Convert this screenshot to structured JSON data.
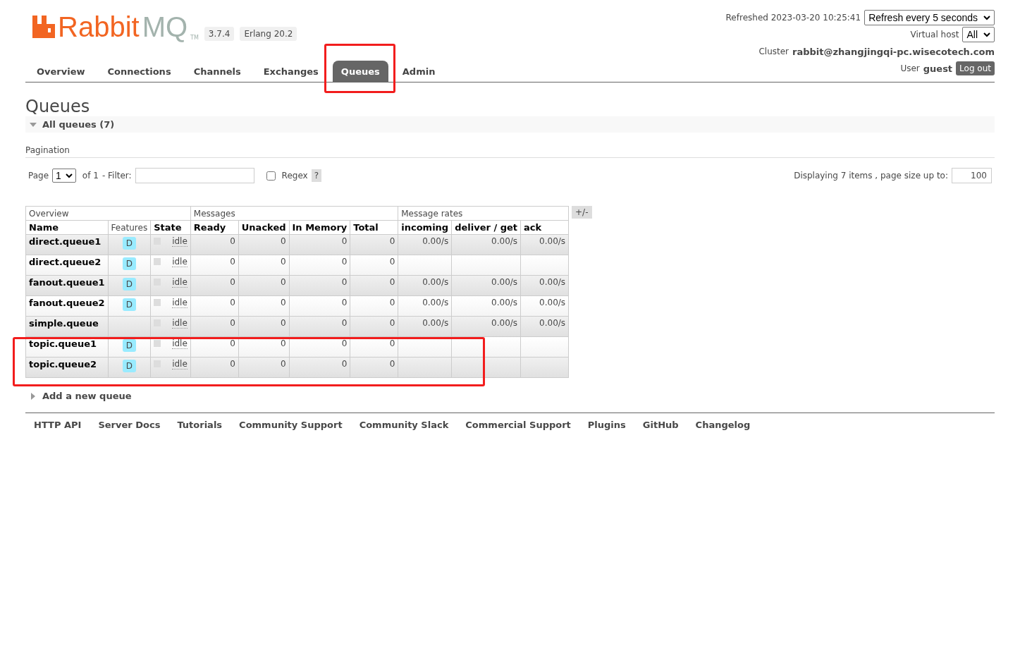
{
  "header": {
    "logo": {
      "word": "Rabbit",
      "accent": "MQ",
      "mark": "TM"
    },
    "version": "3.7.4",
    "erlang": "Erlang 20.2",
    "refreshed": "Refreshed 2023-03-20 10:25:41",
    "refresh_select": "Refresh every 5 seconds",
    "vhost_label": "Virtual host",
    "vhost_select": "All",
    "cluster_label": "Cluster",
    "cluster": "rabbit@zhangjingqi-pc.wisecotech.com",
    "user_label": "User",
    "user": "guest",
    "logout": "Log out"
  },
  "tabs": [
    {
      "label": "Overview",
      "selected": false,
      "highlighted": false
    },
    {
      "label": "Connections",
      "selected": false,
      "highlighted": false
    },
    {
      "label": "Channels",
      "selected": false,
      "highlighted": false
    },
    {
      "label": "Exchanges",
      "selected": false,
      "highlighted": false
    },
    {
      "label": "Queues",
      "selected": true,
      "highlighted": true
    },
    {
      "label": "Admin",
      "selected": false,
      "highlighted": false
    }
  ],
  "page_title": "Queues",
  "section": {
    "title": "All queues (7)",
    "expanded": true
  },
  "pagination": {
    "heading": "Pagination",
    "page_label": "Page",
    "page": "1",
    "of": "of 1",
    "filter_label": "- Filter:",
    "regex_label": "Regex",
    "regex_checked": false,
    "help": "?",
    "displaying": "Displaying 7 items , page size up to:",
    "page_size": "100"
  },
  "table": {
    "groups": [
      {
        "label": "Overview"
      },
      {
        "label": "Messages"
      },
      {
        "label": "Message rates"
      }
    ],
    "toggle": "+/-",
    "columns": [
      "Name",
      "Features",
      "State",
      "Ready",
      "Unacked",
      "In Memory",
      "Total",
      "incoming",
      "deliver / get",
      "ack"
    ],
    "rows": [
      {
        "name": "direct.queue1",
        "features": [
          "D"
        ],
        "state": "idle",
        "ready": "0",
        "unacked": "0",
        "in_memory": "0",
        "total": "0",
        "incoming": "0.00/s",
        "deliver_get": "0.00/s",
        "ack": "0.00/s",
        "highlighted": false
      },
      {
        "name": "direct.queue2",
        "features": [
          "D"
        ],
        "state": "idle",
        "ready": "0",
        "unacked": "0",
        "in_memory": "0",
        "total": "0",
        "highlighted": false
      },
      {
        "name": "fanout.queue1",
        "features": [
          "D"
        ],
        "state": "idle",
        "ready": "0",
        "unacked": "0",
        "in_memory": "0",
        "total": "0",
        "incoming": "0.00/s",
        "deliver_get": "0.00/s",
        "ack": "0.00/s",
        "highlighted": false
      },
      {
        "name": "fanout.queue2",
        "features": [
          "D"
        ],
        "state": "idle",
        "ready": "0",
        "unacked": "0",
        "in_memory": "0",
        "total": "0",
        "incoming": "0.00/s",
        "deliver_get": "0.00/s",
        "ack": "0.00/s",
        "highlighted": false
      },
      {
        "name": "simple.queue",
        "state": "idle",
        "ready": "0",
        "unacked": "0",
        "in_memory": "0",
        "total": "0",
        "incoming": "0.00/s",
        "deliver_get": "0.00/s",
        "ack": "0.00/s",
        "highlighted": false
      },
      {
        "name": "topic.queue1",
        "features": [
          "D"
        ],
        "state": "idle",
        "ready": "0",
        "unacked": "0",
        "in_memory": "0",
        "total": "0",
        "highlighted": true
      },
      {
        "name": "topic.queue2",
        "features": [
          "D"
        ],
        "state": "idle",
        "ready": "0",
        "unacked": "0",
        "in_memory": "0",
        "total": "0",
        "highlighted": true
      }
    ]
  },
  "add_section": {
    "title": "Add a new queue",
    "expanded": false
  },
  "footer": [
    "HTTP API",
    "Server Docs",
    "Tutorials",
    "Community Support",
    "Community Slack",
    "Commercial Support",
    "Plugins",
    "GitHub",
    "Changelog"
  ]
}
